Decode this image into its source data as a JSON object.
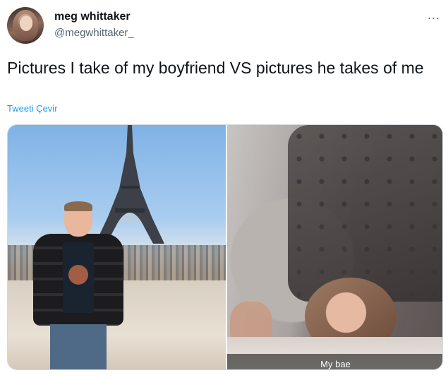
{
  "author": {
    "name": "meg whittaker",
    "handle": "@megwhittaker_"
  },
  "tweet": {
    "text": "Pictures I take of my boyfriend VS pictures he takes of me",
    "translate_label": "Tweeti Çevir"
  },
  "menu": {
    "more_icon": "more-horizontal-icon",
    "more_label": "..."
  },
  "media": {
    "right_caption": "My bae"
  },
  "colors": {
    "link": "#1d9bf0",
    "text": "#0f1419",
    "secondary": "#536471"
  }
}
